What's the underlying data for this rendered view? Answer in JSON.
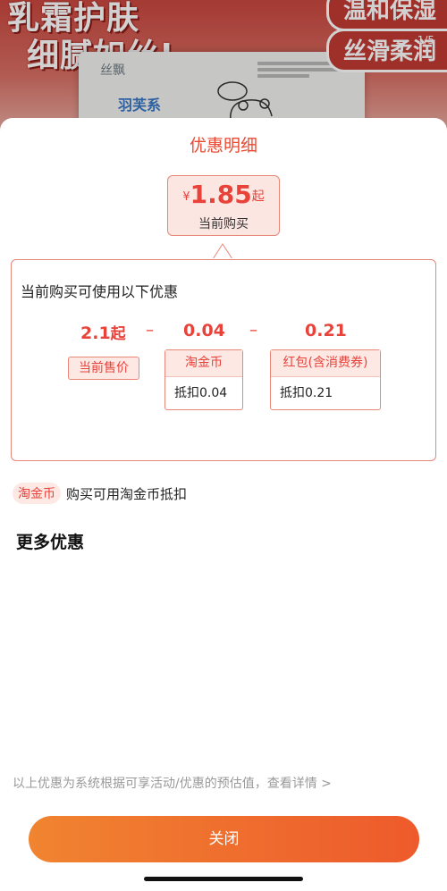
{
  "banner": {
    "headline_line1": "乳霜护肤",
    "headline_line2": "细腻如丝!",
    "pill_1": "温和保湿",
    "pill_2": "丝滑柔润",
    "pager": "1/5",
    "package_brand": "丝飘",
    "package_brand2": "羽芙系"
  },
  "sheet": {
    "title": "优惠明细",
    "price": {
      "currency": "¥",
      "value": "1.85",
      "suffix": "起",
      "subtitle": "当前购买"
    },
    "details": {
      "heading": "当前购买可使用以下优惠",
      "original_value": "2.1",
      "original_suffix": "起",
      "minus": "–",
      "coin_value": "0.04",
      "redpack_value": "0.21",
      "original_tag": "当前售价",
      "coin_tag_title": "淘金币",
      "coin_tag_detail": "抵扣0.04",
      "redpack_tag_title": "红包(含消费券)",
      "redpack_tag_detail": "抵扣0.21"
    },
    "coin_note": {
      "badge": "淘金币",
      "text": "购买可用淘金币抵扣"
    },
    "more_title": "更多优惠",
    "disclaimer": "以上优惠为系统根据可享活动/优惠的预估值，查看详情 >",
    "close_label": "关闭"
  },
  "colors": {
    "accent": "#e8423a",
    "button_start": "#f08430",
    "button_end": "#ee5a2c"
  }
}
